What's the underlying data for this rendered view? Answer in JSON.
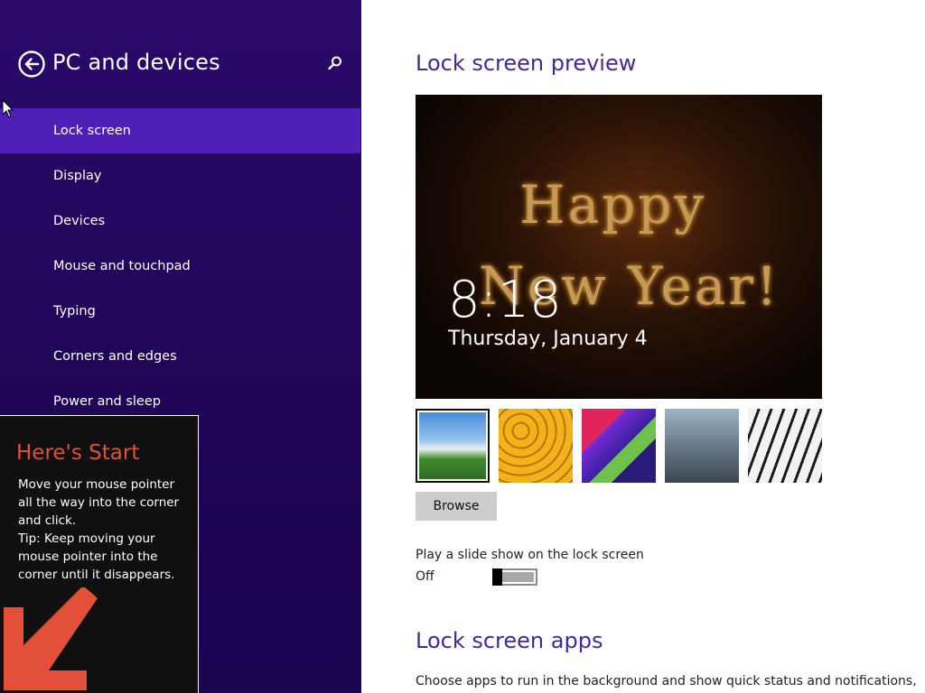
{
  "sidebar": {
    "title": "PC and devices",
    "items": [
      {
        "label": "Lock screen",
        "active": true
      },
      {
        "label": "Display"
      },
      {
        "label": "Devices"
      },
      {
        "label": "Mouse and touchpad"
      },
      {
        "label": "Typing"
      },
      {
        "label": "Corners and edges"
      },
      {
        "label": "Power and sleep"
      }
    ]
  },
  "start_tip": {
    "title": "Here's Start",
    "lines": [
      "Move your mouse pointer all the way into the corner and click.",
      "Tip: Keep moving your mouse pointer into the corner until it disappears."
    ]
  },
  "main": {
    "preview_title": "Lock screen preview",
    "preview": {
      "greeting_line1": "Happy",
      "greeting_line2": "New Year!",
      "time": "8:18",
      "date": "Thursday, January 4"
    },
    "thumbnails": [
      {
        "name": "space-needle-thumb",
        "selected": true
      },
      {
        "name": "honeycomb-thumb"
      },
      {
        "name": "colorful-shapes-thumb"
      },
      {
        "name": "train-station-thumb"
      },
      {
        "name": "piano-keys-thumb"
      }
    ],
    "browse_label": "Browse",
    "slideshow_label": "Play a slide show on the lock screen",
    "slideshow_state": "Off",
    "apps_title": "Lock screen apps",
    "apps_description": "Choose apps to run in the background and show quick status and notifications,"
  },
  "colors": {
    "sidebar_bg": "#1e0556",
    "active_item": "#4f1fb8",
    "section_title": "#3e2a9a",
    "tip_title": "#e2503a"
  }
}
